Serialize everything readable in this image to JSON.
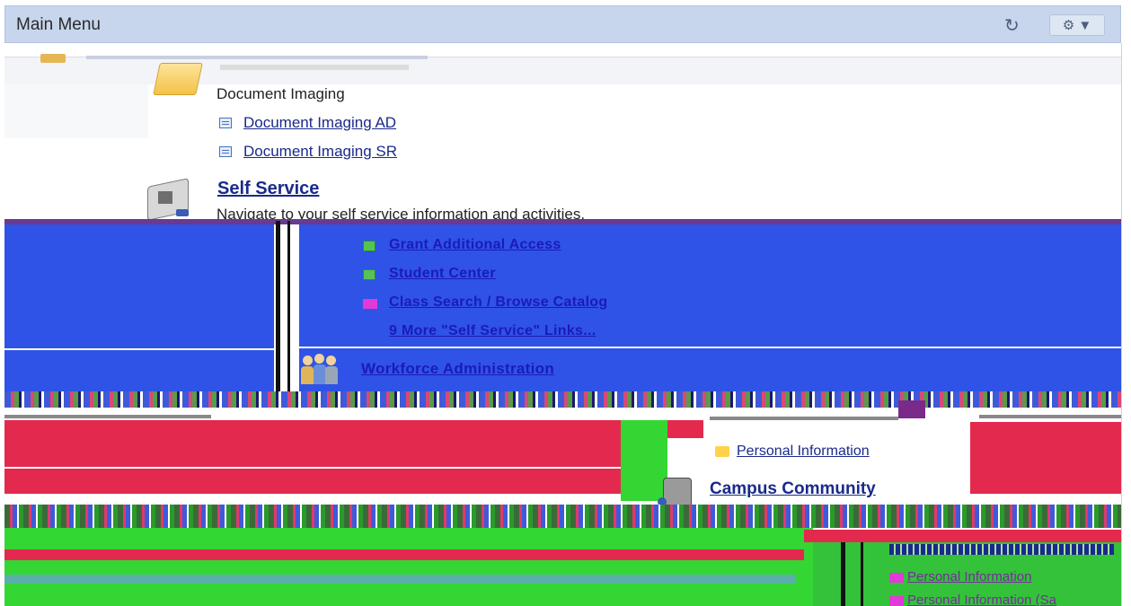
{
  "header": {
    "title": "Main Menu",
    "refresh_icon": "refresh-icon",
    "gear_icon": "gear-icon",
    "gear_caret": "▼"
  },
  "document_imaging": {
    "subtitle": "Document Imaging",
    "links": [
      "Document Imaging AD",
      "Document Imaging SR"
    ]
  },
  "self_service": {
    "title": "Self Service",
    "description": "Navigate to your self service information and activities.",
    "links": [
      "Grant Additional Access",
      "Student Center",
      "Class Search / Browse Catalog"
    ],
    "more_link": "9 More \"Self Service\" Links..."
  },
  "workforce": {
    "title": "Workforce Administration"
  },
  "campus_community": {
    "links": [
      "Personal Information"
    ],
    "title": "Campus Community"
  },
  "lower_links": [
    "Personal Information",
    "Personal Information (Sa"
  ],
  "colors": {
    "header_bg": "#c7d6ec",
    "link": "#1a2a8a",
    "glitch_blue": "#2f53e6",
    "glitch_red": "#e32a4e",
    "glitch_green": "#33d633"
  }
}
